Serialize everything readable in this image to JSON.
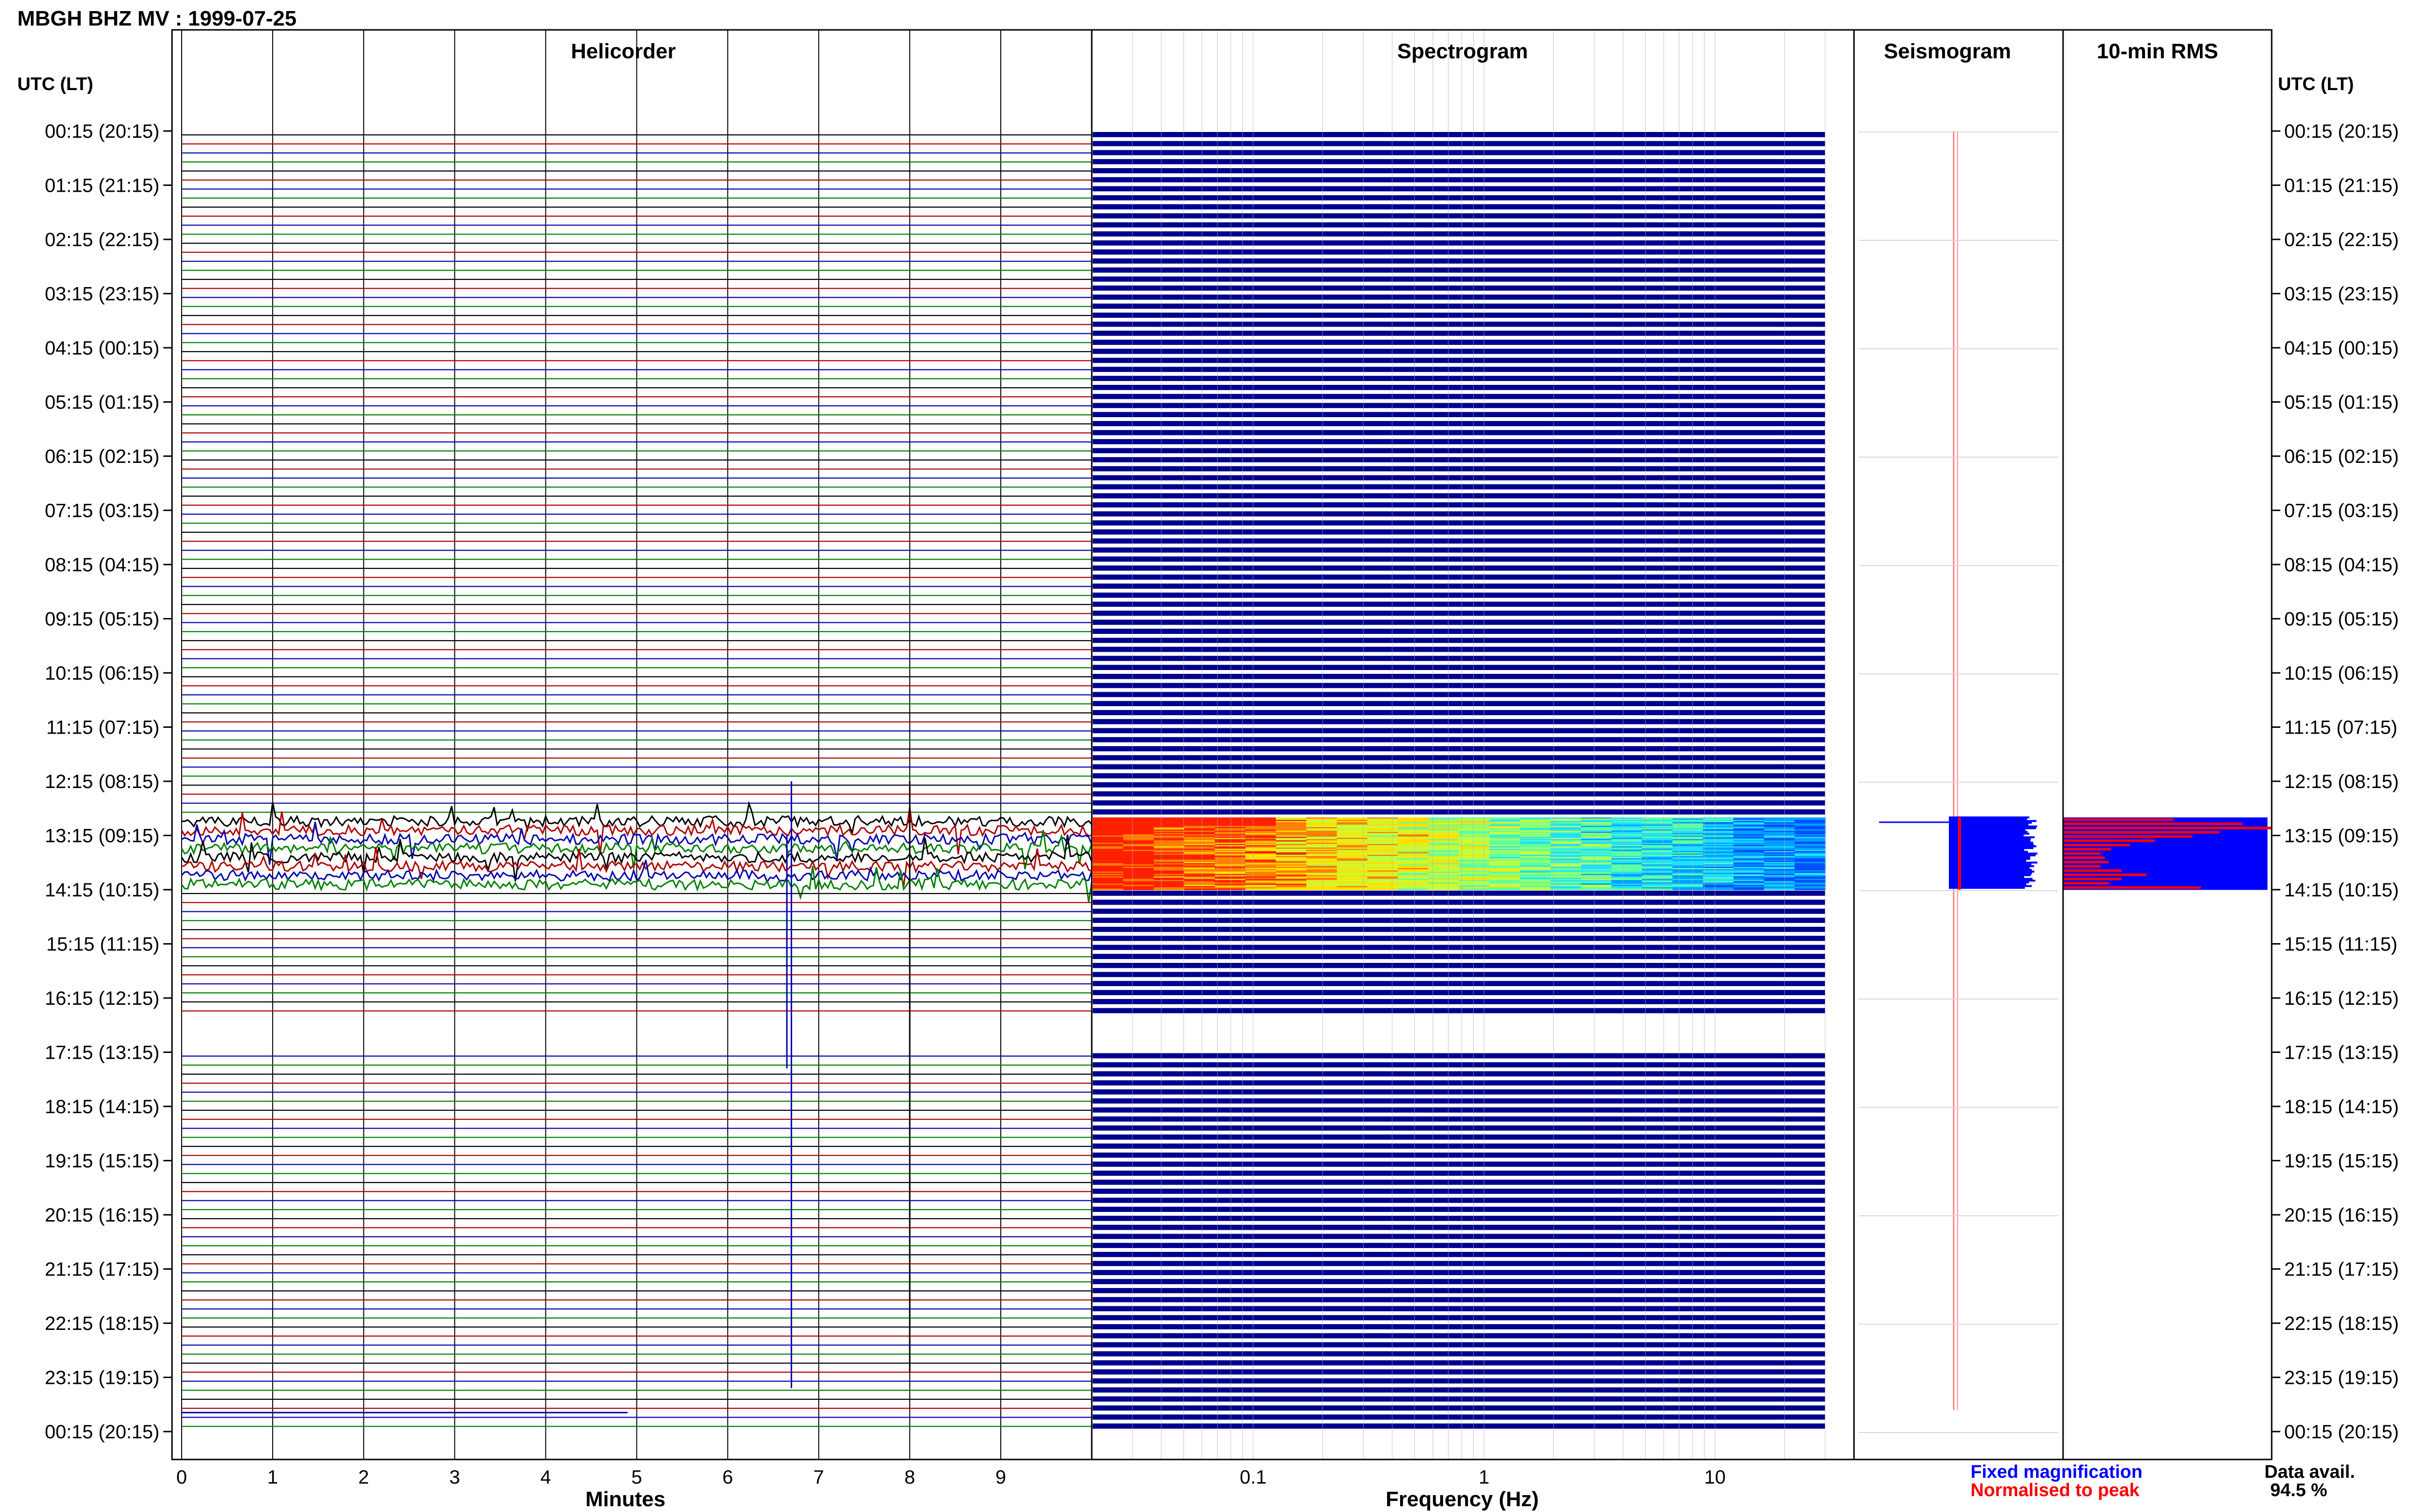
{
  "header": {
    "title": "MBGH BHZ MV : 1999-07-25"
  },
  "panels": {
    "helicorder": "Helicorder",
    "spectrogram": "Spectrogram",
    "seismogram": "Seismogram",
    "rms": "10-min RMS"
  },
  "axes": {
    "left_time_header": "UTC (LT)",
    "right_time_header": "UTC (LT)",
    "minutes_label": "Minutes",
    "frequency_label": "Frequency (Hz)"
  },
  "legend": {
    "fixed": "Fixed magnification",
    "normalised": "Normalised to peak",
    "fixed_color": "#0000ff",
    "normalised_color": "#ff0000"
  },
  "data_availability": {
    "label": "Data avail.",
    "value": "94.5 %"
  },
  "chart_data": {
    "type": "heatmap",
    "title": "MBGH BHZ MV : 1999-07-25",
    "time_labels": [
      "00:15 (20:15)",
      "01:15 (21:15)",
      "02:15 (22:15)",
      "03:15 (23:15)",
      "04:15 (00:15)",
      "05:15 (01:15)",
      "06:15 (02:15)",
      "07:15 (03:15)",
      "08:15 (04:15)",
      "09:15 (05:15)",
      "10:15 (06:15)",
      "11:15 (07:15)",
      "12:15 (08:15)",
      "13:15 (09:15)",
      "14:15 (10:15)",
      "15:15 (11:15)",
      "16:15 (12:15)",
      "17:15 (13:15)",
      "18:15 (14:15)",
      "19:15 (15:15)",
      "20:15 (16:15)",
      "21:15 (17:15)",
      "22:15 (18:15)",
      "23:15 (19:15)",
      "00:15 (20:15)"
    ],
    "minutes_ticks": [
      "0",
      "1",
      "2",
      "3",
      "4",
      "5",
      "6",
      "7",
      "8",
      "9"
    ],
    "minutes_range": [
      0,
      10
    ],
    "frequency_ticks": [
      "0.1",
      "1",
      "10"
    ],
    "frequency_range_hz": [
      0.02,
      40
    ],
    "frequency_scale": "log",
    "trace_colors": [
      "#000000",
      "#b00000",
      "#0000b0",
      "#008000"
    ],
    "active_window_utc": [
      "12:55",
      "14:15"
    ],
    "data_gap_utc": [
      "16:35",
      "17:15"
    ],
    "rms_fixed": [
      0.98,
      0.98,
      0.98,
      0.98,
      0.98,
      0.98,
      0.98,
      0.98,
      0.98,
      0.98,
      0.98,
      0.98,
      0.98,
      0.98,
      0.98,
      0.98,
      0.98
    ],
    "rms_normalised": [
      0.53,
      0.86,
      1.0,
      0.75,
      0.62,
      0.44,
      0.32,
      0.23,
      0.18,
      0.2,
      0.22,
      0.18,
      0.28,
      0.4,
      0.28,
      0.22,
      0.66
    ],
    "data_availability_percent": 94.5
  }
}
